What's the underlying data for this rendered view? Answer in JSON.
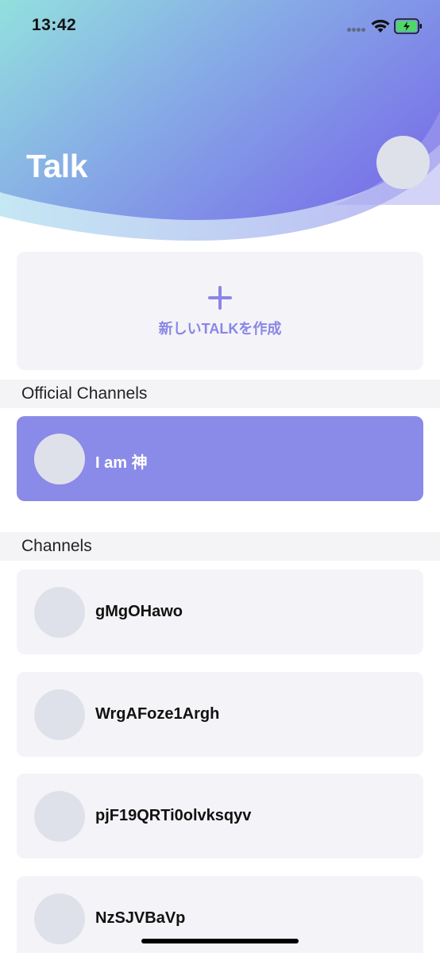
{
  "status_bar": {
    "time": "13:42"
  },
  "header": {
    "title": "Talk"
  },
  "create_talk": {
    "label": "新しいTALKを作成"
  },
  "official_section": {
    "title": "Official Channels",
    "channels": [
      {
        "name": "I am 神"
      }
    ]
  },
  "channels_section": {
    "title": "Channels",
    "channels": [
      {
        "name": "gMgOHawo"
      },
      {
        "name": "WrgAFoze1Argh"
      },
      {
        "name": "pjF19QRTi0olvksqyv"
      },
      {
        "name": "NzSJVBaVp"
      }
    ]
  },
  "colors": {
    "accent": "#8a86e6",
    "official_card": "#8a8ae8",
    "card_background": "#f4f4f8",
    "header_gradient_start": "#8fdfdf",
    "header_gradient_end": "#7a78e6"
  },
  "icons": {
    "create": "plus-icon",
    "wifi": "wifi-icon",
    "battery": "battery-charging-icon",
    "signal": "cellular-signal-icon"
  }
}
